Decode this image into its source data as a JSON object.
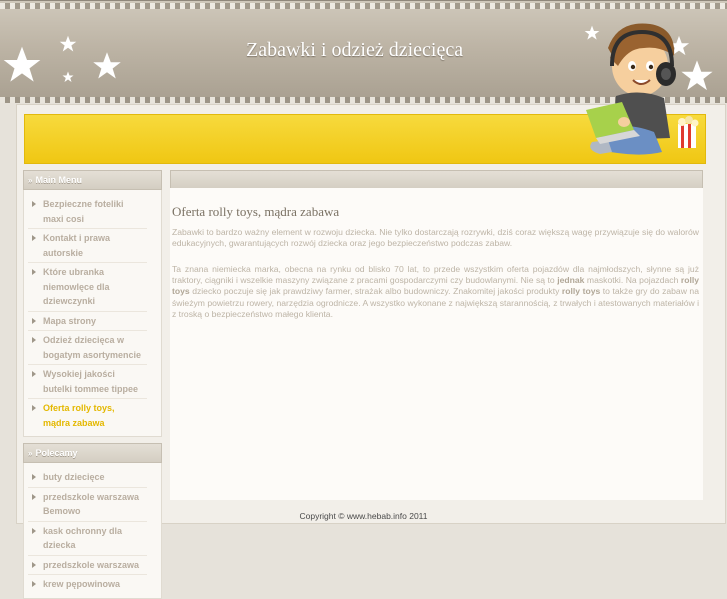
{
  "header": {
    "site_title": "Zabawki i odzież dziecięca"
  },
  "sidebar": {
    "main_menu": {
      "title": "Main Menu",
      "items": [
        "Bezpieczne foteliki maxi cosi",
        "Kontakt i prawa autorskie",
        "Które ubranka niemowlęce dla dziewczynki",
        "Mapa strony",
        "Odzież dziecięca w bogatym asortymencie",
        "Wysokiej jakości butelki tommee tippee",
        "Oferta rolly toys, mądra zabawa"
      ],
      "active_index": 6
    },
    "polecamy": {
      "title": "Polecamy",
      "items": [
        "buty dziecięce",
        "przedszkole warszawa Bemowo",
        "kask ochronny dla dziecka",
        "przedszkole warszawa",
        "krew pępowinowa"
      ]
    }
  },
  "article": {
    "title": "Oferta rolly toys, mądra zabawa",
    "paragraph1": "Zabawki to bardzo ważny element w rozwoju dziecka. Nie tylko dostarczają rozrywki, dziś coraz większą wagę przywiązuje się do walorów edukacyjnych, gwarantujących rozwój dziecka oraz jego bezpieczeństwo podczas zabaw.",
    "paragraph2": {
      "part1": "Ta znana niemiecka marka, obecna na rynku od blisko 70 lat, to przede wszystkim oferta pojazdów dla najmłodszych, słynne są już traktory, ciągniki i wszelkie maszyny związane z pracami gospodarczymi czy budowlanymi. Nie są to ",
      "bold1": "jednak",
      "part2": " maskotki. Na pojazdach ",
      "bold2": "rolly toys",
      "part3": " dziecko poczuje się jak prawdziwy farmer, strażak albo budowniczy. Znakomitej jakości produkty ",
      "bold3": "rolly toys",
      "part4": " to także gry do zabaw na świeżym powietrzu rowery, narzędzia ogrodnicze. A wszystko wykonane z największą starannością, z trwałych i atestowanych materiałów i z troską o bezpieczeństwo małego klienta."
    }
  },
  "footer": {
    "copyright": "Copyright © www.hebab.info 2011"
  },
  "colors": {
    "banner": "#f0c713",
    "active_menu": "#e4b800",
    "header": "#bdb4a5"
  }
}
